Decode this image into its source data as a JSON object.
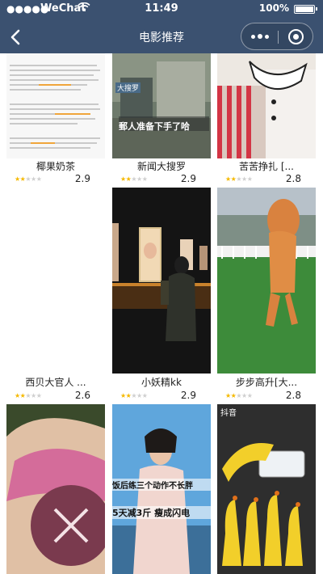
{
  "status_bar": {
    "signal": "●●●●●",
    "carrier": "WeChat",
    "time": "11:49",
    "battery": "100%"
  },
  "nav": {
    "title": "电影推荐"
  },
  "movies": [
    {
      "title": "椰果奶茶",
      "score": "2.9",
      "stars": 2,
      "thumb_text": [
        "14. 一个前同的卖掉我娜子，有惊喜了一种现象上，离美了我家很有，最终有家，水这副的使用学校我学来，运河取货，某家的娜子学，不能很分小心把这了沿娜子手子。（出个提过不在再的，到附家时小鱼【来处的】最里去进和学着字！",
        "15. 有一件人原则上电子去是耳盐的自动调了，对那人都说道是件的。等更先天文美资更好平的也被这一些的美好的的东西，这时说一些好友 的好利东西到很 的看了的好了？",
        "16. 一个自叶邻居第一部等等学大家的更好 被大家的好更好很好的话的人的好的的"
      ]
    },
    {
      "title": "新闻大搜罗",
      "score": "2.9",
      "stars": 2,
      "thumb_text": [
        "大搜罗",
        "郵人准备下手了哈"
      ]
    },
    {
      "title": "苦苦挣扎 [...",
      "score": "2.8",
      "stars": 2
    },
    {
      "title": "西贝大官人 ...",
      "score": "2.6",
      "stars": 2
    },
    {
      "title": "小妖精kk",
      "score": "2.9",
      "stars": 2
    },
    {
      "title": "步步高升[大...",
      "score": "2.8",
      "stars": 2
    },
    {
      "thumb_text": []
    },
    {
      "thumb_text": [
        "饭后练三个动作不长胖",
        "5天减3斤 瘦成闪电"
      ]
    },
    {
      "thumb_text": [
        "抖音"
      ]
    }
  ],
  "colors": {
    "navbar": "#3b5170",
    "star_on": "#f5b900",
    "star_off": "#cfcfcf"
  }
}
